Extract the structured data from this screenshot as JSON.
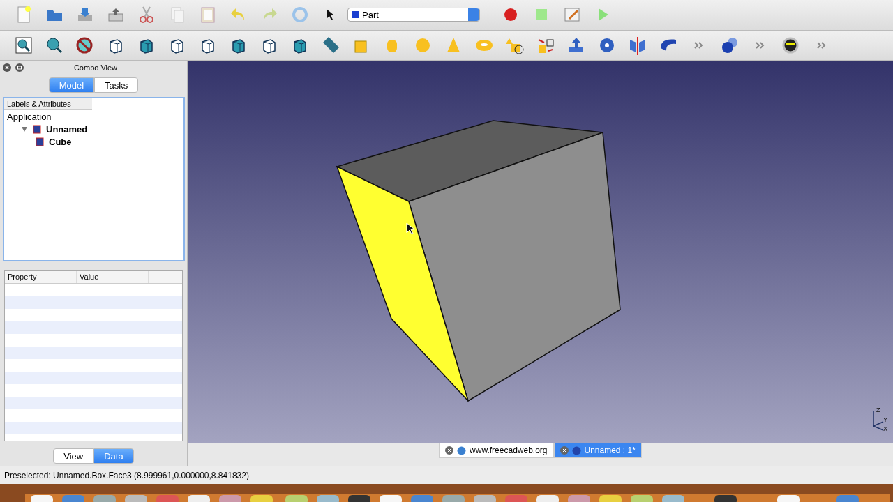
{
  "toolbar": {
    "workbench": "Part"
  },
  "combo_view": {
    "title": "Combo View",
    "tabs": [
      {
        "label": "Model",
        "selected": true
      },
      {
        "label": "Tasks",
        "selected": false
      }
    ]
  },
  "tree": {
    "header": "Labels & Attributes",
    "items": [
      {
        "label": "Application",
        "children": [
          {
            "label": "Unnamed",
            "expanded": true,
            "children": [
              {
                "label": "Cube"
              }
            ]
          }
        ]
      }
    ]
  },
  "property_table": {
    "columns": [
      "Property",
      "Value"
    ]
  },
  "property_tabs": [
    {
      "label": "View",
      "selected": false
    },
    {
      "label": "Data",
      "selected": true
    }
  ],
  "axes": [
    "Z",
    "Y",
    "X"
  ],
  "document_tabs": [
    {
      "label": "www.freecadweb.org",
      "selected": false
    },
    {
      "label": "Unnamed : 1*",
      "selected": true
    }
  ],
  "status_bar": "Preselected: Unnamed.Box.Face3 (8.999961,0.000000,8.841832)"
}
